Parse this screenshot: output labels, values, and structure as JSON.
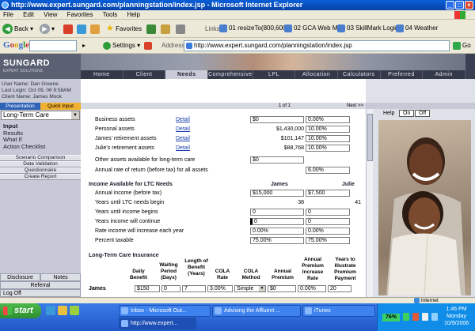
{
  "browser": {
    "title": "http://www.expert.sungard.com/planningstation/index.jsp - Microsoft Internet Explorer",
    "menu": [
      "File",
      "Edit",
      "View",
      "Favorites",
      "Tools",
      "Help"
    ],
    "back_label": "Back",
    "favorites_label": "Favorites",
    "links_label": "Links",
    "links": [
      "01 resizeTo(800,600)",
      "02 GCA Web Mail",
      "03 SkillMark Login",
      "04 Weather"
    ],
    "google_label": "Google",
    "settings_label": "Settings",
    "address_label": "Address",
    "address_value": "http://www.expert.sungard.com/planningstation/index.jsp",
    "go_label": "Go",
    "status_zone": "Internet"
  },
  "app": {
    "logo": "SUNGARD",
    "logo_sub": "EXPERT SOLUTIONS",
    "tabs": [
      "Home",
      "Client",
      "Needs Analysis",
      "Comprehensive",
      "LPL",
      "Allocation Master",
      "Calculators",
      "Preferred",
      "Admin"
    ],
    "active_tab": "Needs Analysis"
  },
  "sidebar": {
    "user_name": "User Name: Dan Greene",
    "last_login": "Last Login: Oct 09, 06 9:58AM",
    "client_name": "Client Name: James Mock",
    "presentation_label": "Presentation",
    "quick_input_label": "Quick Input",
    "topic_value": "Long-Term Care",
    "subnav": [
      "Input",
      "Results",
      "What If",
      "Action Checklist"
    ],
    "buttons": [
      "Scenario Comparison",
      "Data Validation",
      "Questionnaire",
      "Create Report"
    ],
    "disclosure_label": "Disclosure",
    "notes_label": "Notes",
    "referral_label": "Referral",
    "logoff_label": "Log Off"
  },
  "main": {
    "page_indicator": "1 of 1",
    "next_label": "Next >>",
    "assets": [
      {
        "label": "Business assets",
        "detail": "Detail",
        "value": "$0",
        "pct": "0.00%"
      },
      {
        "label": "Personal assets",
        "detail": "Detail",
        "value": "$1,430,000",
        "pct": "10.00%"
      },
      {
        "label": "James' retirement assets",
        "detail": "Detail",
        "value": "$101,147",
        "pct": "10.00%"
      },
      {
        "label": "Julie's retirement assets",
        "detail": "Detail",
        "value": "$88,768",
        "pct": "10.00%"
      }
    ],
    "other_assets_label": "Other assets available for long-term care",
    "other_assets_value": "$0",
    "annual_rate_label": "Annual rate of return (before tax) for all assets",
    "annual_rate_value": "6.00%",
    "income_section": "Income Available for LTC Needs",
    "col_james": "James",
    "col_julie": "Julie",
    "income_rows": [
      {
        "label": "Annual income (before tax)",
        "james": "$15,000",
        "julie": "$7,500",
        "input": true
      },
      {
        "label": "Years until LTC needs begin",
        "james": "38",
        "julie": "41",
        "input": false
      },
      {
        "label": "Years until income begins",
        "james": "0",
        "julie": "0",
        "input": true
      },
      {
        "label": "Years income will continue",
        "james": "0",
        "julie": "0",
        "input": true
      },
      {
        "label": "Rate income will increase each year",
        "james": "0.00%",
        "julie": "0.00%",
        "input": true
      },
      {
        "label": "Percent taxable",
        "james": "75.00%",
        "julie": "75.00%",
        "input": true
      }
    ],
    "ltc_section": "Long-Term Care Insurance",
    "ltc_headers": [
      "Daily Benefit",
      "Waiting Period (Days)",
      "Length of Benefit (Years)",
      "COLA Rate",
      "COLA Method",
      "Annual Premium",
      "Annual Premium Increase Rate",
      "Years to Illustrate Premium Payment"
    ],
    "ltc_row_label": "James",
    "ltc_values": [
      "$150",
      "0",
      "7",
      "3.00%",
      "Simple",
      "$0",
      "0.00%",
      "20"
    ]
  },
  "right_panel": {
    "help_label": "Help",
    "on_label": "On",
    "off_label": "Off"
  },
  "taskbar": {
    "start_label": "start",
    "tasks": [
      "Inbox - Microsoft Out...",
      "Advising the Affluent ...",
      "iTunes",
      "http://www.expert..."
    ],
    "battery": "76%",
    "time": "1:46 PM",
    "day": "Monday",
    "date": "10/9/2006"
  }
}
